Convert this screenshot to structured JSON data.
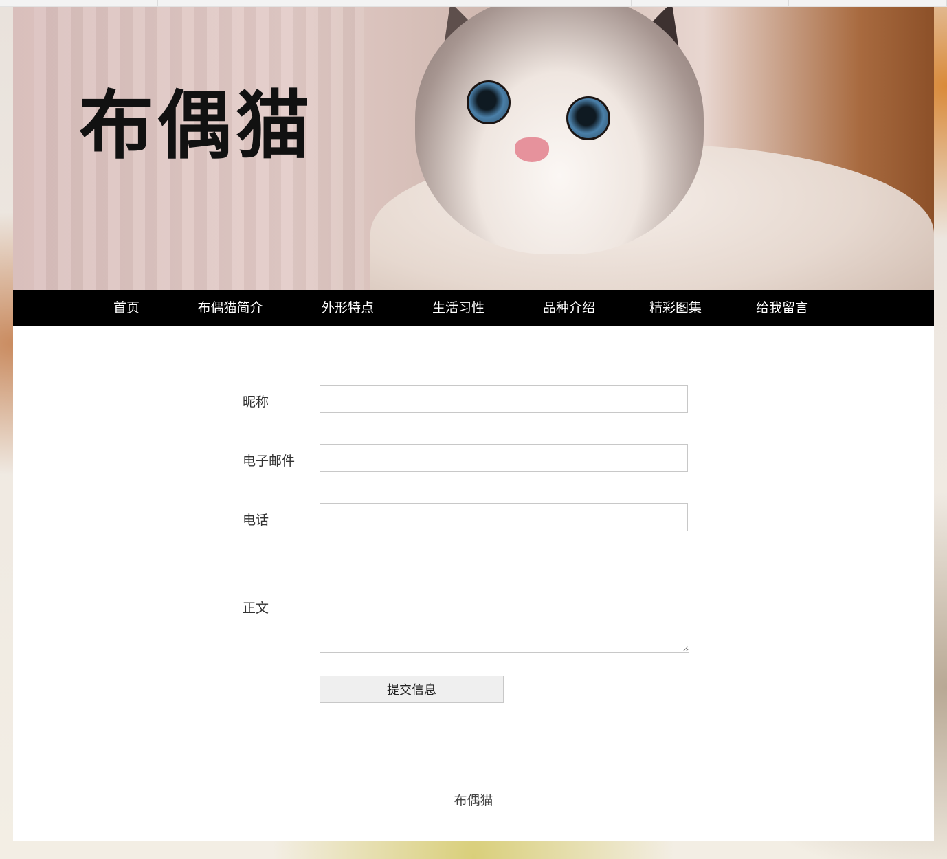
{
  "site": {
    "banner_title": "布偶猫",
    "footer_text": "布偶猫"
  },
  "nav": {
    "items": [
      {
        "label": "首页"
      },
      {
        "label": "布偶猫简介"
      },
      {
        "label": "外形特点"
      },
      {
        "label": "生活习性"
      },
      {
        "label": "品种介绍"
      },
      {
        "label": "精彩图集"
      },
      {
        "label": "给我留言"
      }
    ]
  },
  "form": {
    "nickname": {
      "label": "昵称",
      "value": ""
    },
    "email": {
      "label": "电子邮件",
      "value": ""
    },
    "phone": {
      "label": "电话",
      "value": ""
    },
    "message": {
      "label": "正文",
      "value": ""
    },
    "submit_label": "提交信息"
  },
  "colors": {
    "nav_background": "#000000",
    "nav_text": "#ffffff",
    "page_background": "#ffffff"
  }
}
